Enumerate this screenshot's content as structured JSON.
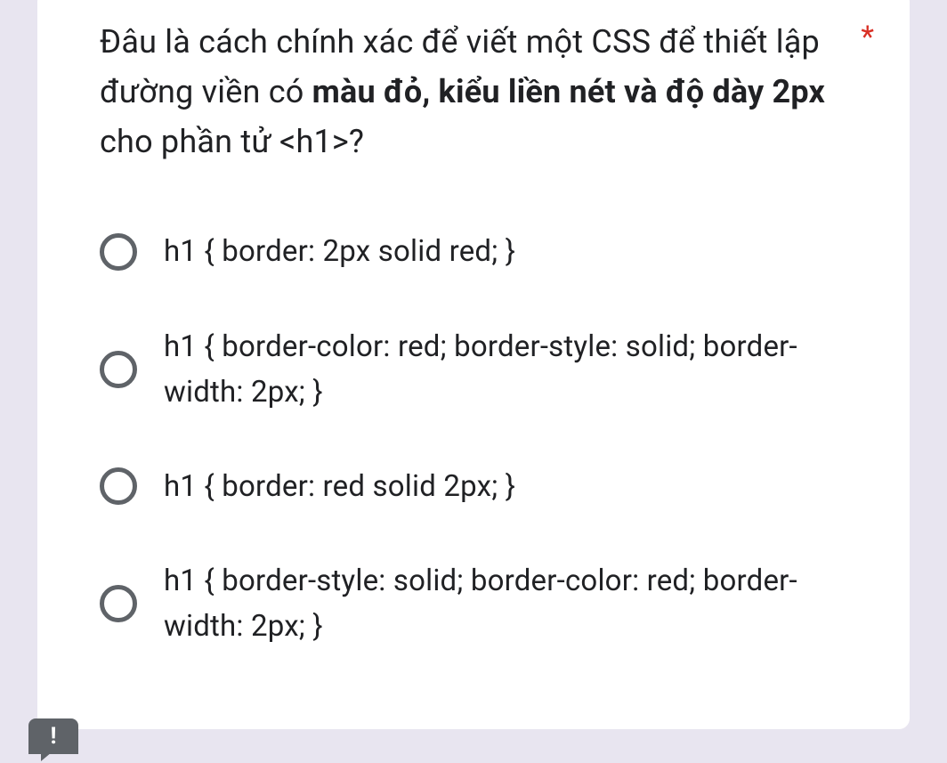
{
  "question": {
    "part1": "Đâu là cách chính xác để viết một CSS  để thiết lập đường viền có ",
    "bold": "màu đỏ, kiểu liền nét và độ dày 2px",
    "part2": " cho phần tử <h1>?",
    "required_mark": "*"
  },
  "options": [
    "h1 { border: 2px solid red; }",
    "h1 { border-color: red; border-style: solid; border-width: 2px; }",
    "h1 { border: red solid 2px; }",
    "h1 { border-style: solid; border-color: red; border-width: 2px; }"
  ],
  "report_icon_label": "!"
}
